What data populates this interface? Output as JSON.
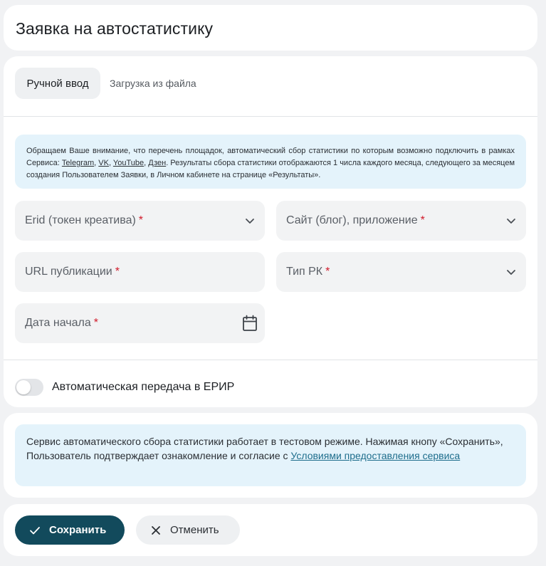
{
  "header": {
    "title": "Заявка на автостатистику"
  },
  "tabs": [
    {
      "label": "Ручной ввод",
      "active": true
    },
    {
      "label": "Загрузка из файла",
      "active": false
    }
  ],
  "notice_top": {
    "text_1": "Обращаем Ваше внимание, что перечень площадок, автоматический сбор статистики по которым возможно подключить в рамках Сервиса: ",
    "links": [
      "Telegram",
      "VK",
      "YouTube",
      "Дзен"
    ],
    "sep": ", ",
    "text_2": ". Результаты сбора статистики отображаются 1 числа каждого месяца, следующего за месяцем создания Пользователем Заявки, в Личном кабинете на странице «Результаты»."
  },
  "fields": {
    "erid": {
      "label": "Erid (токен креатива)",
      "required_mark": "*",
      "icon": "chevron-down-icon"
    },
    "site": {
      "label": "Сайт (блог), приложение",
      "required_mark": "*",
      "icon": "chevron-down-icon"
    },
    "url": {
      "label": "URL публикации",
      "required_mark": "*"
    },
    "rk_type": {
      "label": "Тип РК",
      "required_mark": "*",
      "icon": "chevron-down-icon"
    },
    "start_date": {
      "label": "Дата начала",
      "required_mark": "*",
      "icon": "calendar-icon"
    }
  },
  "toggle": {
    "label": "Автоматическая передача в ЕРИР",
    "on": false
  },
  "notice_bottom": {
    "text": "Сервис автоматического сбора статистики работает в тестовом режиме. Нажимая кнопу «Сохранить», Пользователь подтверждает ознакомление и согласие с ",
    "link": "Условиями предоставления сервиса"
  },
  "actions": {
    "save_label": "Сохранить",
    "cancel_label": "Отменить"
  },
  "colors": {
    "primary": "#124a5c",
    "required": "#d11a2a",
    "info_bg": "#e4f3fb",
    "link": "#1d6d8c"
  }
}
